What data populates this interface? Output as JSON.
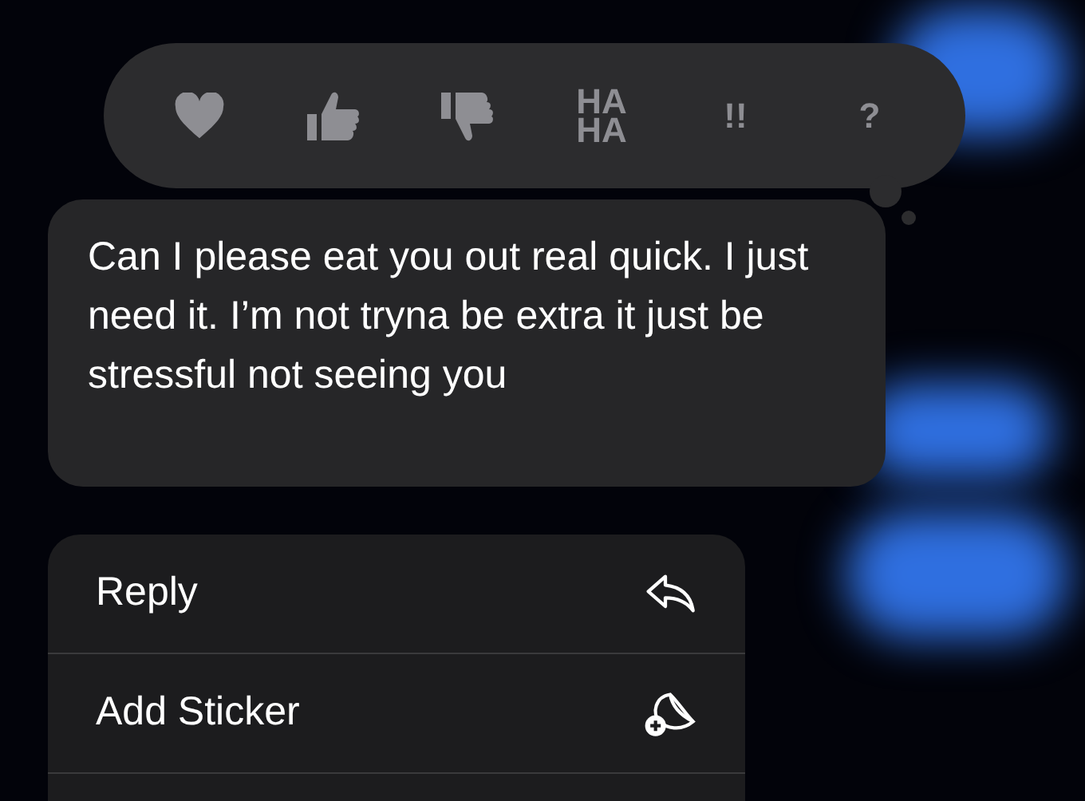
{
  "tapback_bar": {
    "reactions": [
      {
        "kind": "heart"
      },
      {
        "kind": "thumbs-up"
      },
      {
        "kind": "thumbs-down"
      },
      {
        "kind": "text",
        "label": "HA HA"
      },
      {
        "kind": "text",
        "label": "!!"
      },
      {
        "kind": "text",
        "label": "?"
      }
    ]
  },
  "message": {
    "text": "Can I please eat you out real quick. I just need it. I’m not tryna be extra it just be stressful not seeing you"
  },
  "menu": {
    "items": [
      {
        "label": "Reply",
        "kind": "reply"
      },
      {
        "label": "Add Sticker",
        "kind": "sticker"
      }
    ]
  }
}
